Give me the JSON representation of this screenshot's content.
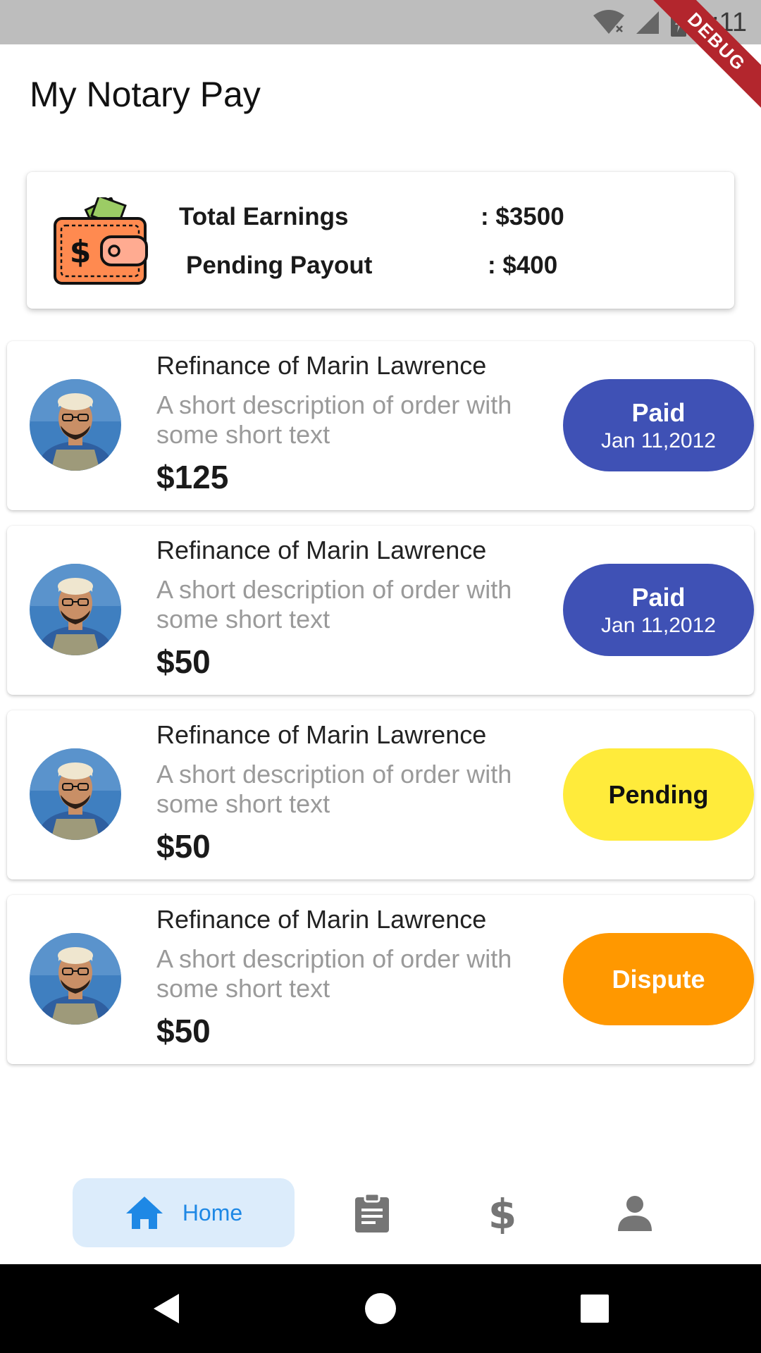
{
  "status_bar": {
    "time": "3:11",
    "debug_label": "DEBUG"
  },
  "app": {
    "title": "My Notary Pay"
  },
  "summary": {
    "total_earnings_label": "Total Earnings",
    "total_earnings_value": ": $3500",
    "pending_payout_label": "Pending Payout",
    "pending_payout_value": ": $400"
  },
  "orders": [
    {
      "title": "Refinance of Marin Lawrence",
      "description": "A short description of order with some short text",
      "amount": "$125",
      "status": "Paid",
      "date": "Jan 11,2012",
      "status_color": "#3f51b5",
      "text_color": "#ffffff"
    },
    {
      "title": "Refinance of Marin Lawrence",
      "description": "A short description of order with some short text",
      "amount": "$50",
      "status": "Paid",
      "date": "Jan 11,2012",
      "status_color": "#3f51b5",
      "text_color": "#ffffff"
    },
    {
      "title": "Refinance of Marin Lawrence",
      "description": "A short description of order with some short text",
      "amount": "$50",
      "status": "Pending",
      "date": "",
      "status_color": "#ffeb3b",
      "text_color": "#111111"
    },
    {
      "title": "Refinance of Marin Lawrence",
      "description": "A short description of order with some short text",
      "amount": "$50",
      "status": "Dispute",
      "date": "",
      "status_color": "#ff9800",
      "text_color": "#ffffff"
    }
  ],
  "bottom_nav": {
    "home_label": "Home",
    "items": [
      "home-icon",
      "clipboard-icon",
      "dollar-icon",
      "person-icon"
    ],
    "active_color": "#1e88e5",
    "active_bg": "#dcecfb",
    "inactive_color": "#757575"
  }
}
